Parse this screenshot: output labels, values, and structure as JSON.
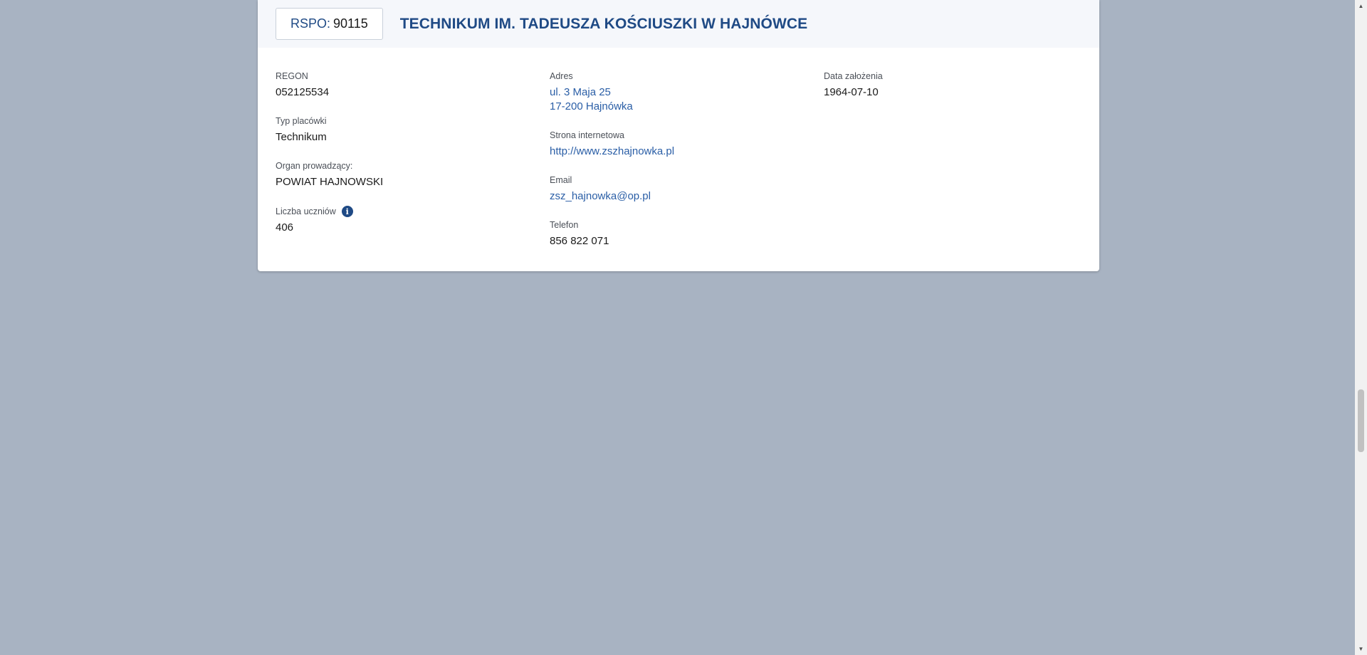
{
  "header": {
    "rspo_label": "RSPO:",
    "rspo_value": "90115",
    "school_name": "TECHNIKUM IM. TADEUSZA KOŚCIUSZKI W HAJNÓWCE"
  },
  "col1": {
    "regon": {
      "label": "REGON",
      "value": "052125534"
    },
    "typ": {
      "label": "Typ placówki",
      "value": "Technikum"
    },
    "organ": {
      "label": "Organ prowadzący:",
      "value": "POWIAT HAJNOWSKI"
    },
    "uczniowie": {
      "label": "Liczba uczniów",
      "value": "406",
      "icon": "info-icon"
    }
  },
  "col2": {
    "adres": {
      "label": "Adres",
      "line1": "ul. 3 Maja 25",
      "line2": "17-200 Hajnówka"
    },
    "www": {
      "label": "Strona internetowa",
      "value": "http://www.zszhajnowka.pl"
    },
    "email": {
      "label": "Email",
      "value": "zsz_hajnowka@op.pl"
    },
    "telefon": {
      "label": "Telefon",
      "value": "856 822 071"
    }
  },
  "col3": {
    "data_zalozenia": {
      "label": "Data założenia",
      "value": "1964-07-10"
    }
  },
  "colors": {
    "background": "#a8b3c2",
    "accent": "#1f4a85",
    "link": "#2a5ea6"
  },
  "scrollbar": {
    "icons": [
      "scroll-up-arrow-icon",
      "scroll-down-arrow-icon"
    ]
  }
}
